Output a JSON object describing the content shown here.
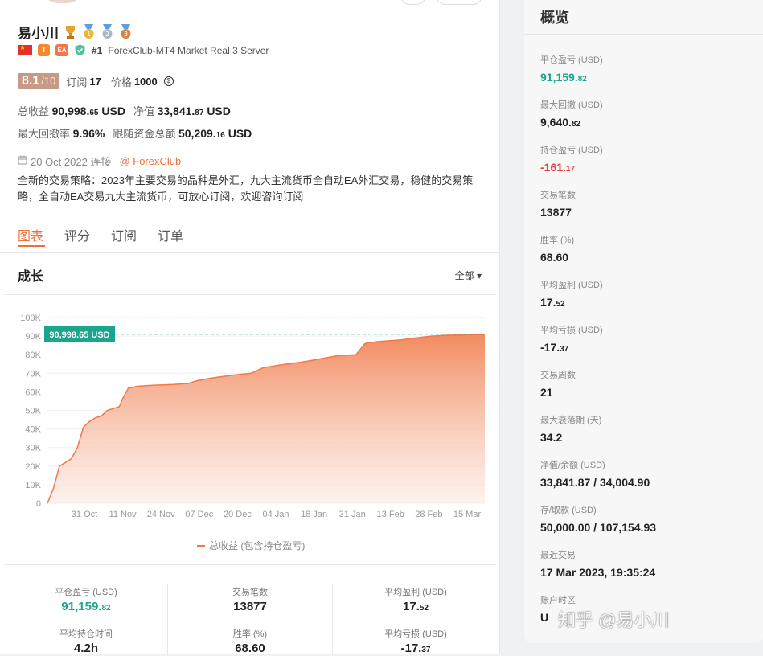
{
  "profile": {
    "name": "易小川",
    "rank": "#1",
    "server": "ForexClub-MT4 Market Real 3 Server",
    "tag_t": "T",
    "tag_ea": "EA",
    "score": "8.1",
    "score_den": "/10",
    "subs_label": "订阅",
    "subs_value": "17",
    "price_label": "价格",
    "price_value": "1000"
  },
  "summary": {
    "total_gain_label": "总收益",
    "total_gain_main": "90,998.",
    "total_gain_dec": "65",
    "total_gain_unit": "USD",
    "equity_label": "净值",
    "equity_main": "33,841.",
    "equity_dec": "87",
    "equity_unit": "USD",
    "max_dd_label": "最大回撤率",
    "max_dd_value": "9.96%",
    "follow_label": "跟随资金总额",
    "follow_main": "50,209.",
    "follow_dec": "16",
    "follow_unit": "USD"
  },
  "connect": {
    "date": "20 Oct 2022 连接",
    "broker": "@ ForexClub"
  },
  "description": "全新的交易策略：2023年主要交易的品种是外汇，九大主流货币全自动EA外汇交易，稳健的交易策略，全自动EA交易九大主流货币，可放心订阅，欢迎咨询订阅",
  "tabs": [
    "图表",
    "评分",
    "订阅",
    "订单"
  ],
  "growth": {
    "title": "成长",
    "range": "全部 ▾"
  },
  "chart_data": {
    "type": "area",
    "series": [
      {
        "name": "总收益 (包含持仓盈亏)",
        "color": "#f28a5e"
      }
    ],
    "x_ticks": [
      "31 Oct",
      "11 Nov",
      "24 Nov",
      "07 Dec",
      "20 Dec",
      "04 Jan",
      "18 Jan",
      "31 Jan",
      "13 Feb",
      "28 Feb",
      "15 Mar"
    ],
    "y_ticks": [
      "0",
      "10K",
      "20K",
      "30K",
      "40K",
      "50K",
      "60K",
      "70K",
      "80K",
      "90K",
      "100K"
    ],
    "ylim": [
      0,
      100000
    ],
    "x_range": [
      0,
      146
    ],
    "points": [
      [
        0,
        0
      ],
      [
        2,
        8000
      ],
      [
        4,
        20000
      ],
      [
        6,
        22000
      ],
      [
        8,
        24000
      ],
      [
        10,
        30000
      ],
      [
        12,
        41000
      ],
      [
        14,
        44000
      ],
      [
        16,
        46000
      ],
      [
        18,
        47000
      ],
      [
        20,
        50000
      ],
      [
        22,
        51000
      ],
      [
        24,
        52000
      ],
      [
        25,
        56000
      ],
      [
        27,
        62000
      ],
      [
        30,
        63000
      ],
      [
        35,
        63500
      ],
      [
        42,
        64000
      ],
      [
        47,
        64500
      ],
      [
        50,
        66000
      ],
      [
        55,
        67500
      ],
      [
        62,
        69000
      ],
      [
        68,
        70000
      ],
      [
        72,
        73000
      ],
      [
        78,
        74500
      ],
      [
        85,
        76000
      ],
      [
        92,
        78000
      ],
      [
        97,
        79500
      ],
      [
        103,
        80000
      ],
      [
        106,
        86000
      ],
      [
        110,
        87000
      ],
      [
        118,
        88000
      ],
      [
        123,
        89000
      ],
      [
        128,
        90000
      ],
      [
        135,
        90500
      ],
      [
        146,
        90998.65
      ]
    ],
    "current_label": "90,998.65 USD",
    "current_value": 90998.65,
    "legend_position": "bottom"
  },
  "bottom_stats": [
    {
      "label": "平仓盈亏 (USD)",
      "main": "91,159.",
      "dec": "82",
      "green": true
    },
    {
      "label": "交易笔数",
      "main": "13877",
      "dec": "",
      "green": false
    },
    {
      "label": "平均盈利 (USD)",
      "main": "17.",
      "dec": "52",
      "green": false
    },
    {
      "label": "平均持仓时间",
      "main": "4.2h",
      "dec": "",
      "green": false
    },
    {
      "label": "胜率 (%)",
      "main": "68.60",
      "dec": "",
      "green": false
    },
    {
      "label": "平均亏损 (USD)",
      "main": "-17.",
      "dec": "37",
      "green": false
    }
  ],
  "overview": {
    "title": "概览",
    "items": [
      {
        "label": "平仓盈亏 (USD)",
        "main": "91,159.",
        "dec": "82",
        "style": "green"
      },
      {
        "label": "最大回撤 (USD)",
        "main": "9,640.",
        "dec": "82",
        "style": ""
      },
      {
        "label": "持仓盈亏 (USD)",
        "main": "-161.",
        "dec": "17",
        "style": "red"
      },
      {
        "label": "交易笔数",
        "main": "13877",
        "dec": "",
        "style": ""
      },
      {
        "label": "胜率 (%)",
        "main": "68.60",
        "dec": "",
        "style": ""
      },
      {
        "label": "平均盈利 (USD)",
        "main": "17.",
        "dec": "52",
        "style": ""
      },
      {
        "label": "平均亏损 (USD)",
        "main": "-17.",
        "dec": "37",
        "style": ""
      },
      {
        "label": "交易周数",
        "main": "21",
        "dec": "",
        "style": ""
      },
      {
        "label": "最大衰落期 (天)",
        "main": "34.2",
        "dec": "",
        "style": ""
      },
      {
        "label": "净值/余额 (USD)",
        "main": "33,841.87 / 34,004.90",
        "dec": "",
        "style": ""
      },
      {
        "label": "存/取款 (USD)",
        "main": "50,000.00 / 107,154.93",
        "dec": "",
        "style": ""
      },
      {
        "label": "最近交易",
        "main": "17 Mar 2023, 19:35:24",
        "dec": "",
        "style": ""
      },
      {
        "label": "账户时区",
        "main": "U",
        "dec": "",
        "style": ""
      }
    ]
  },
  "watermark": "知乎 @易小川",
  "colors": {
    "accent": "#f0703a",
    "green": "#1aa58d",
    "red": "#e84040",
    "area": "#f28a5e"
  }
}
